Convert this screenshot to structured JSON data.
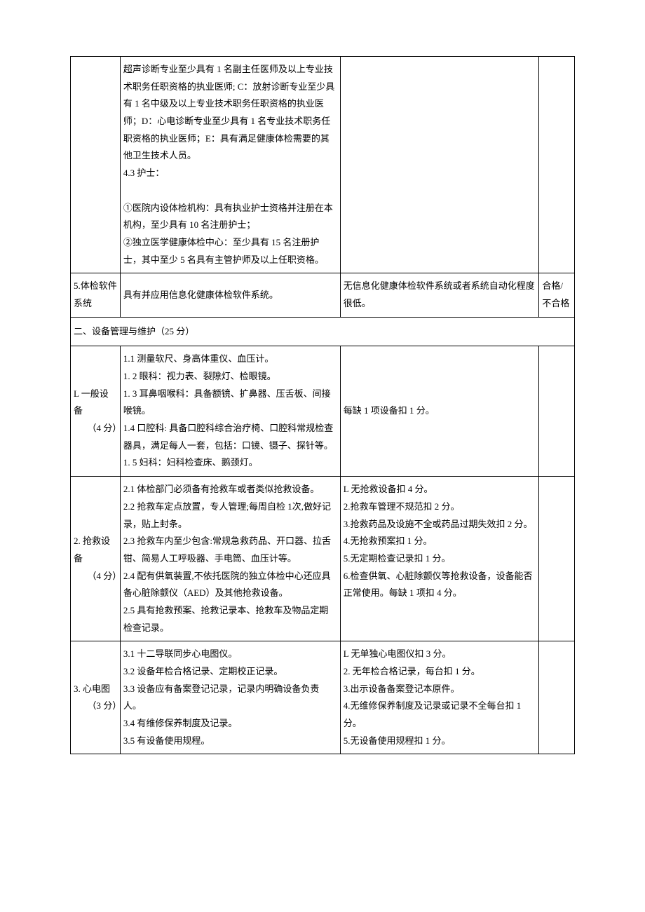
{
  "rows": [
    {
      "c1": "",
      "c2": "超声诊断专业至少具有 1 名副主任医师及以上专业技术职务任职资格的执业医师; C：放射诊断专业至少具有 1 名中级及以上专业技术职务任职资格的执业医师；D：心电诊断专业至少具有 1 名专业技术职务任职资格的执业医师；E：具有满足健康体检需要的其他卫生技术人员。\n4.3 护士：\n\n①医院内设体检机构：具有执业护士资格并注册在本机构，至少具有 10 名注册护士；\n②独立医学健康体检中心：至少具有 15 名注册护士，其中至少 5 名具有主管护师及以上任职资格。",
      "c3": "",
      "c4": ""
    },
    {
      "c1": "5.体检软件系统",
      "c2": "具有并应用信息化健康体检软件系统。",
      "c3": "无信息化健康体检软件系统或者系统自动化程度很低。",
      "c4": "合格/不合格"
    }
  ],
  "section2_title": "二、设备管理与维护（25 分）",
  "rows2": [
    {
      "c1": "L 一般设备\n　　（4 分）",
      "c2": "1.1 测量软尺、身高体重仪、血压计。\n1. 2 眼科：视力表、裂隙灯、检眼镜。\n1. 3 耳鼻咽喉科：具备额镜、扩鼻器、压舌板、间接喉镜。\n1.4 口腔科: 具备口腔科综合治疗椅、口腔科常规检查器具，满足每人一套，包括：口镜、镊子、探针等。\n1. 5 妇科：妇科检查床、鹅颈灯。",
      "c3": "每缺 1 项设备扣 1 分。",
      "c4": ""
    },
    {
      "c1": "2. 抢救设备\n　　（4 分）",
      "c2": "2.1 体检部门必须备有抢救车或者类似抢救设备。\n2.2 抢救车定点放置，专人管理;每周自检 1次,做好记录，贴上封条。\n2.3 抢救车内至少包含:常规急救药品、开口器、拉舌钳、简易人工呼吸器、手电筒、血压计等。\n2.4 配有供氧装置,不依托医院的独立体检中心还应具备心脏除颤仪（AED）及其他抢救设备。\n2.5 具有抢救预案、抢救记录本、抢救车及物品定期检查记录。",
      "c3": "L 无抢救设备扣 4 分。\n2.抢救车管理不规范扣 2 分。\n3.抢救药品及设施不全或药品过期失效扣 2 分。\n4.无抢救预案扣 1 分。\n5.无定期检查记录扣 1 分。\n6.检查供氧、心脏除颤仪等抢救设备，设备能否正常使用。每缺 1 项扣 4 分。",
      "c4": ""
    },
    {
      "c1": "3. 心电图\n　　（3 分）",
      "c2": "3.1 十二导联同步心电图仪。\n3.2 设备年检合格记录、定期校正记录。\n3.3 设备应有备案登记记录，记录内明确设备负责人。\n3.4 有维修保养制度及记录。\n3.5 有设备使用规程。",
      "c3": "L 无单独心电图仪扣 3 分。\n2. 无年检合格记录，每台扣 1 分。\n3.出示设备备案登记本原件。\n4.无维修保养制度及记录或记录不全每台扣 1 分。\n5.无设备使用规程扣 1 分。",
      "c4": ""
    }
  ]
}
